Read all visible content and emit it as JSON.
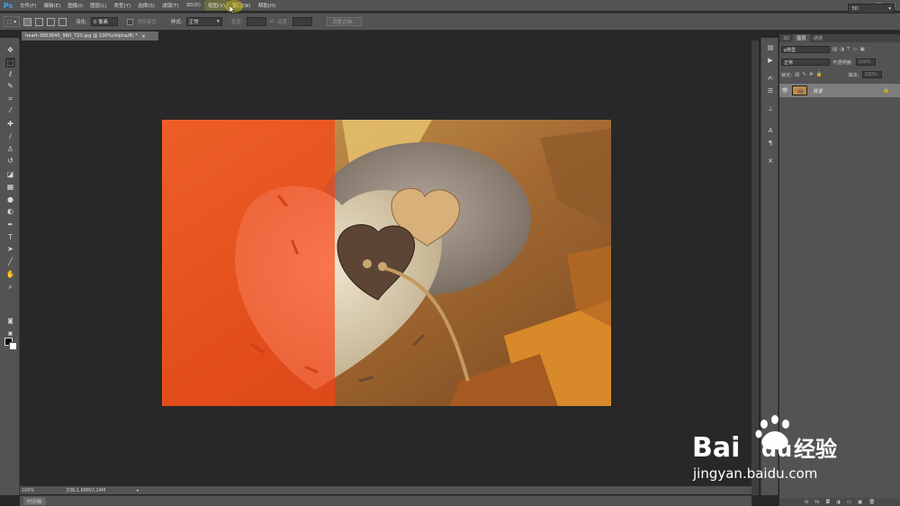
{
  "app": {
    "logo": "Ps",
    "colors": {
      "accent": "#38a4e7",
      "ui_bg": "#535353",
      "canvas_bg": "#282828",
      "menu_highlight": "#6b6b42"
    }
  },
  "menu": {
    "items": [
      {
        "label": "文件(F)"
      },
      {
        "label": "编辑(E)"
      },
      {
        "label": "图像(I)"
      },
      {
        "label": "图层(L)"
      },
      {
        "label": "类型(Y)"
      },
      {
        "label": "选择(S)"
      },
      {
        "label": "滤镜(T)"
      },
      {
        "label": "3D(D)"
      },
      {
        "label": "视图(V)"
      },
      {
        "label": "窗口(W)"
      },
      {
        "label": "帮助(H)"
      }
    ],
    "highlighted_index": 8
  },
  "window_controls": {
    "minimize": "—",
    "maximize": "□",
    "close": "×"
  },
  "options": {
    "feather_label": "羽化:",
    "feather_value": "0 像素",
    "antialias_label": "消除锯齿",
    "style_label": "样式:",
    "style_value": "正常",
    "width_label": "宽度:",
    "height_label": "高度:",
    "swap_symbol": "⇄",
    "refine_edge_label": "调整边缘...",
    "workspace_value": "3D"
  },
  "document": {
    "tab_title": "heart-3063845_960_720.jpg @ 100%(Alpha/8) *",
    "close": "×"
  },
  "status": {
    "zoom": "100%",
    "doc_info": "文档:1.68M/2.24M",
    "arrow": "▸",
    "timeline_tab": "时间轴"
  },
  "tools": [
    {
      "name": "move-tool-icon",
      "glyph": "✥"
    },
    {
      "name": "marquee-tool-icon",
      "glyph": "⬚"
    },
    {
      "name": "lasso-tool-icon",
      "glyph": "ℓ"
    },
    {
      "name": "quick-select-tool-icon",
      "glyph": "✎"
    },
    {
      "name": "crop-tool-icon",
      "glyph": "⌗"
    },
    {
      "name": "eyedropper-tool-icon",
      "glyph": "⁄"
    },
    {
      "name": "healing-brush-tool-icon",
      "glyph": "✚"
    },
    {
      "name": "brush-tool-icon",
      "glyph": "/"
    },
    {
      "name": "clone-stamp-tool-icon",
      "glyph": "♙"
    },
    {
      "name": "history-brush-tool-icon",
      "glyph": "↺"
    },
    {
      "name": "eraser-tool-icon",
      "glyph": "◪"
    },
    {
      "name": "gradient-tool-icon",
      "glyph": "▦"
    },
    {
      "name": "blur-tool-icon",
      "glyph": "●"
    },
    {
      "name": "dodge-tool-icon",
      "glyph": "◐"
    },
    {
      "name": "pen-tool-icon",
      "glyph": "✒"
    },
    {
      "name": "type-tool-icon",
      "glyph": "T"
    },
    {
      "name": "path-select-tool-icon",
      "glyph": "➤"
    },
    {
      "name": "line-tool-icon",
      "glyph": "╱"
    },
    {
      "name": "hand-tool-icon",
      "glyph": "✋"
    },
    {
      "name": "zoom-tool-icon",
      "glyph": "⌕"
    }
  ],
  "dock_icons": [
    {
      "name": "history-panel-icon",
      "glyph": "▤"
    },
    {
      "name": "actions-panel-icon",
      "glyph": "▶"
    },
    {
      "name": "brush-panel-icon",
      "glyph": "✍"
    },
    {
      "name": "adjustments-panel-icon",
      "glyph": "☰"
    },
    {
      "name": "properties-panel-icon",
      "glyph": "⊥"
    },
    {
      "name": "character-panel-icon",
      "glyph": "A"
    },
    {
      "name": "paragraph-panel-icon",
      "glyph": "¶"
    },
    {
      "name": "tool-presets-panel-icon",
      "glyph": "✕"
    }
  ],
  "layers_panel": {
    "tabs": [
      "3D",
      "图层",
      "通道"
    ],
    "active_tab": 1,
    "filter_kind": "ρ类型",
    "blend_mode": "正常",
    "opacity_label": "不透明度:",
    "opacity_value": "100%",
    "lock_label": "锁定:",
    "fill_label": "填充:",
    "fill_value": "100%",
    "layers": [
      {
        "name": "背景",
        "visible": true,
        "locked": true
      }
    ],
    "footer_icons": [
      "⊖",
      "fx",
      "◘",
      "◑",
      "▭",
      "▣",
      "🗑"
    ],
    "eye_glyph": "👁",
    "lock_glyph": "🔒"
  },
  "watermark": {
    "logo": "Bai du 经验",
    "url": "jingyan.baidu.com"
  }
}
